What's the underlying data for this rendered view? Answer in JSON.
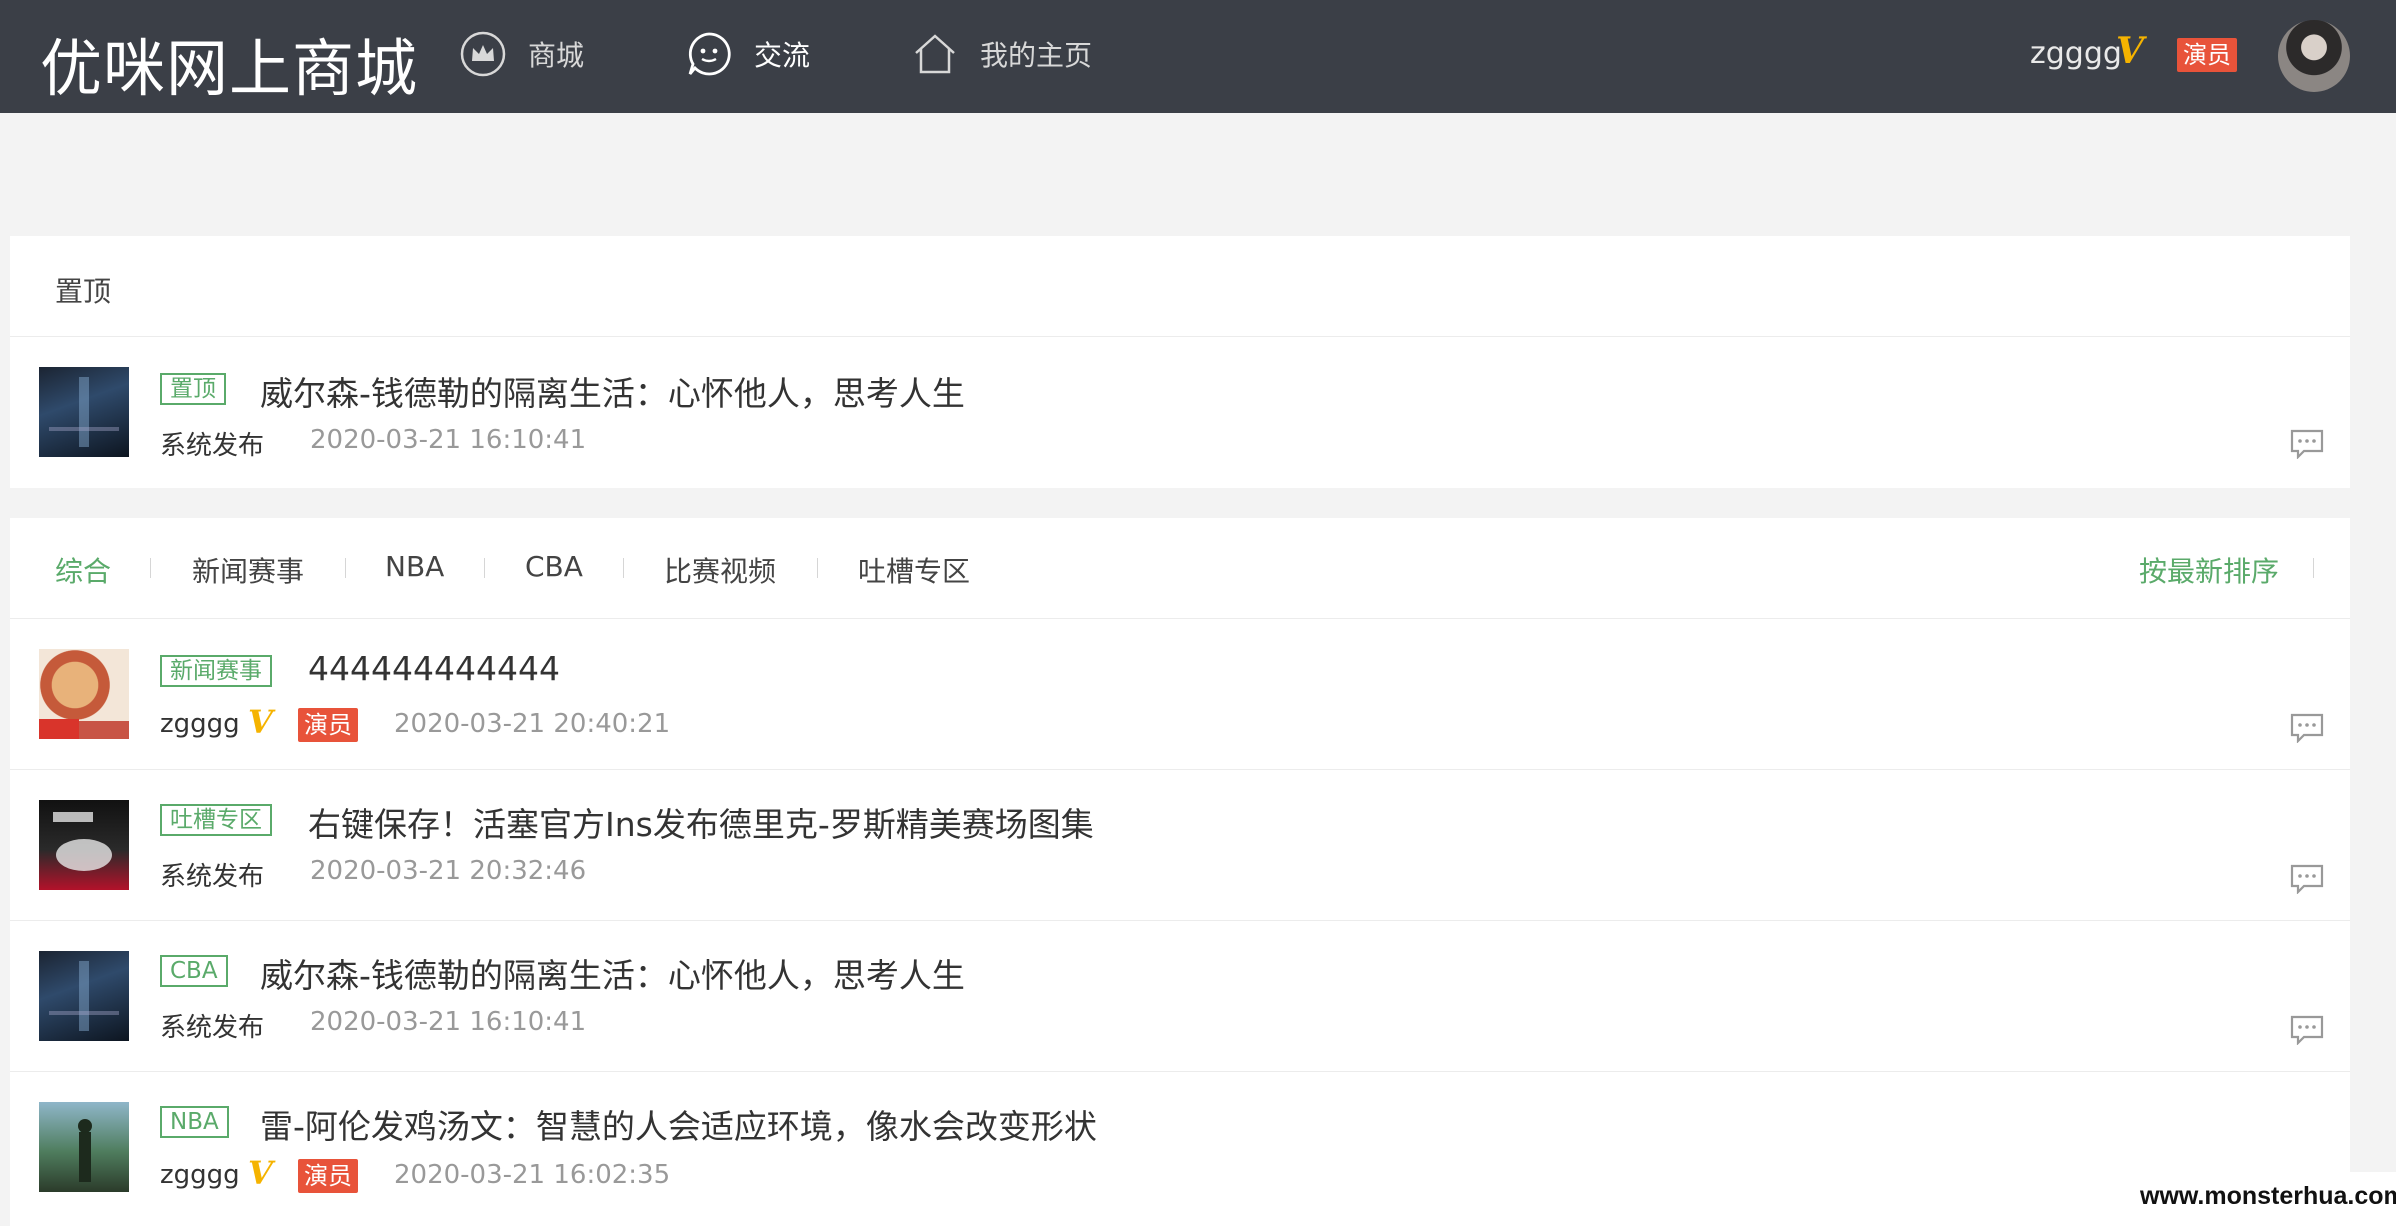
{
  "header": {
    "logo": "优咪网上商城",
    "nav": [
      {
        "label": "商城",
        "icon": "crown-icon"
      },
      {
        "label": "交流",
        "icon": "chat-bubble-icon"
      },
      {
        "label": "我的主页",
        "icon": "home-icon"
      }
    ],
    "active_nav": "交流",
    "user": {
      "name": "zgggg",
      "verified_mark": "V",
      "role": "演员"
    }
  },
  "pinned": {
    "title": "置顶",
    "post": {
      "tag": "置顶",
      "title": "威尔森-钱德勒的隔离生活：心怀他人，思考人生",
      "author": "系统发布",
      "time": "2020-03-21 16:10:41"
    }
  },
  "tabs": {
    "items": [
      "综合",
      "新闻赛事",
      "NBA",
      "CBA",
      "比赛视频",
      "吐槽专区"
    ],
    "active": "综合",
    "sort_label": "按最新排序"
  },
  "posts": [
    {
      "tag": "新闻赛事",
      "title": "444444444444",
      "author": "zgggg",
      "verified_mark": "V",
      "role": "演员",
      "time": "2020-03-21 20:40:21"
    },
    {
      "tag": "吐槽专区",
      "title": "右键保存！活塞官方Ins发布德里克-罗斯精美赛场图集",
      "author": "系统发布",
      "time": "2020-03-21 20:32:46"
    },
    {
      "tag": "CBA",
      "title": "威尔森-钱德勒的隔离生活：心怀他人，思考人生",
      "author": "系统发布",
      "time": "2020-03-21 16:10:41"
    },
    {
      "tag": "NBA",
      "title": "雷-阿伦发鸡汤文：智慧的人会适应环境，像水会改变形状",
      "author": "zgggg",
      "verified_mark": "V",
      "role": "演员",
      "time": "2020-03-21 16:02:35"
    }
  ],
  "watermark": "www.monsterhua.com",
  "colors": {
    "topbar": "#3b3f47",
    "accent_green": "#5aaa6a",
    "role_badge": "#e8533a",
    "verified": "#f5b300"
  }
}
